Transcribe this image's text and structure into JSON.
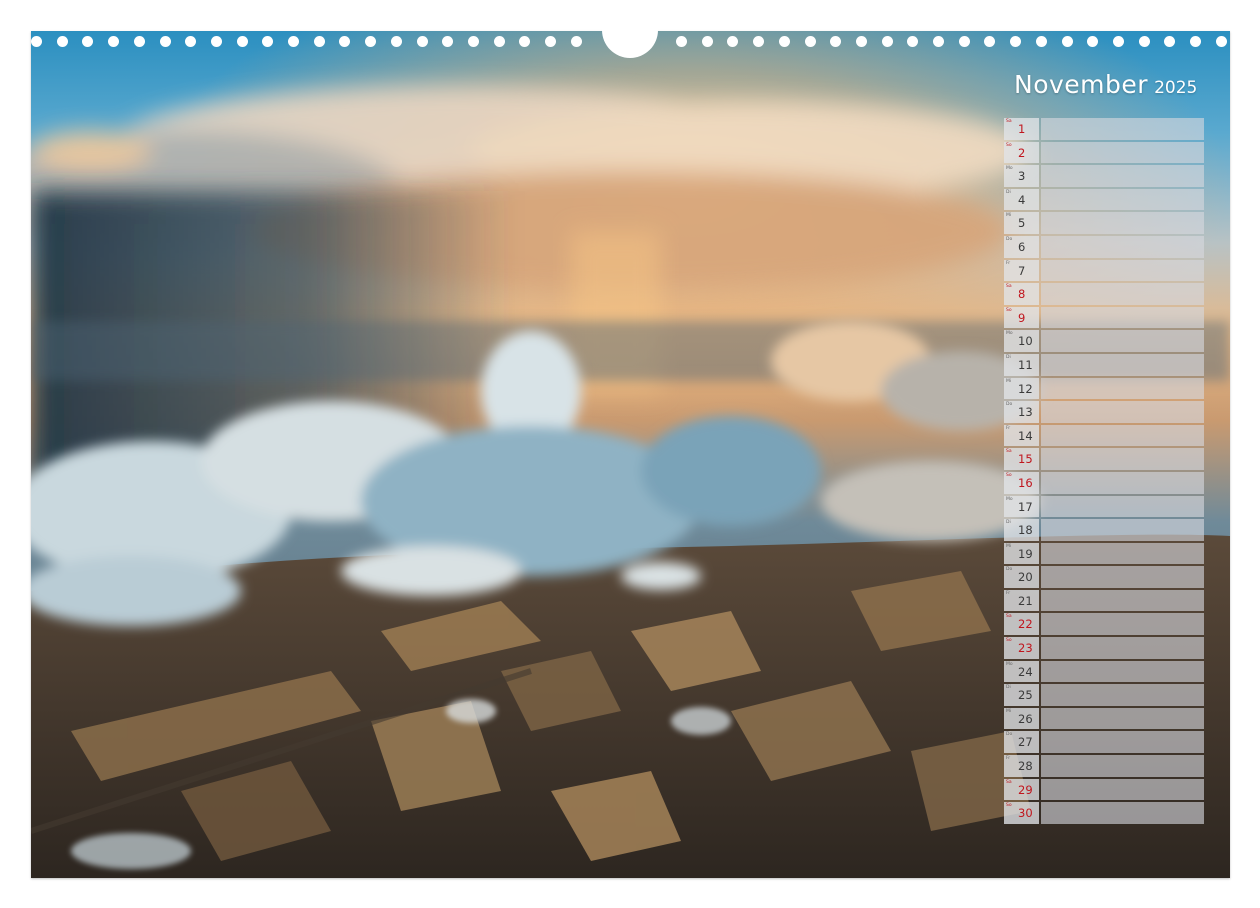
{
  "calendar": {
    "month": "November",
    "year": "2025",
    "days": [
      {
        "day": "1",
        "weekday": "Sa",
        "holiday": true
      },
      {
        "day": "2",
        "weekday": "So",
        "holiday": true
      },
      {
        "day": "3",
        "weekday": "Mo",
        "holiday": false
      },
      {
        "day": "4",
        "weekday": "Di",
        "holiday": false
      },
      {
        "day": "5",
        "weekday": "Mi",
        "holiday": false
      },
      {
        "day": "6",
        "weekday": "Do",
        "holiday": false
      },
      {
        "day": "7",
        "weekday": "Fr",
        "holiday": false
      },
      {
        "day": "8",
        "weekday": "Sa",
        "holiday": true
      },
      {
        "day": "9",
        "weekday": "So",
        "holiday": true
      },
      {
        "day": "10",
        "weekday": "Mo",
        "holiday": false
      },
      {
        "day": "11",
        "weekday": "Di",
        "holiday": false
      },
      {
        "day": "12",
        "weekday": "Mi",
        "holiday": false
      },
      {
        "day": "13",
        "weekday": "Do",
        "holiday": false
      },
      {
        "day": "14",
        "weekday": "Fr",
        "holiday": false
      },
      {
        "day": "15",
        "weekday": "Sa",
        "holiday": true
      },
      {
        "day": "16",
        "weekday": "So",
        "holiday": true
      },
      {
        "day": "17",
        "weekday": "Mo",
        "holiday": false
      },
      {
        "day": "18",
        "weekday": "Di",
        "holiday": false
      },
      {
        "day": "19",
        "weekday": "Mi",
        "holiday": false
      },
      {
        "day": "20",
        "weekday": "Do",
        "holiday": false
      },
      {
        "day": "21",
        "weekday": "Fr",
        "holiday": false
      },
      {
        "day": "22",
        "weekday": "Sa",
        "holiday": true
      },
      {
        "day": "23",
        "weekday": "So",
        "holiday": true
      },
      {
        "day": "24",
        "weekday": "Mo",
        "holiday": false
      },
      {
        "day": "25",
        "weekday": "Di",
        "holiday": false
      },
      {
        "day": "26",
        "weekday": "Mi",
        "holiday": false
      },
      {
        "day": "27",
        "weekday": "Do",
        "holiday": false
      },
      {
        "day": "28",
        "weekday": "Fr",
        "holiday": false
      },
      {
        "day": "29",
        "weekday": "Sa",
        "holiday": true
      },
      {
        "day": "30",
        "weekday": "So",
        "holiday": true
      }
    ]
  },
  "colors": {
    "holiday": "#c0151d",
    "weekday": "#3a3a3a",
    "title": "#ffffff"
  },
  "binding": {
    "hole_count_left": 22,
    "hole_count_right": 22
  }
}
